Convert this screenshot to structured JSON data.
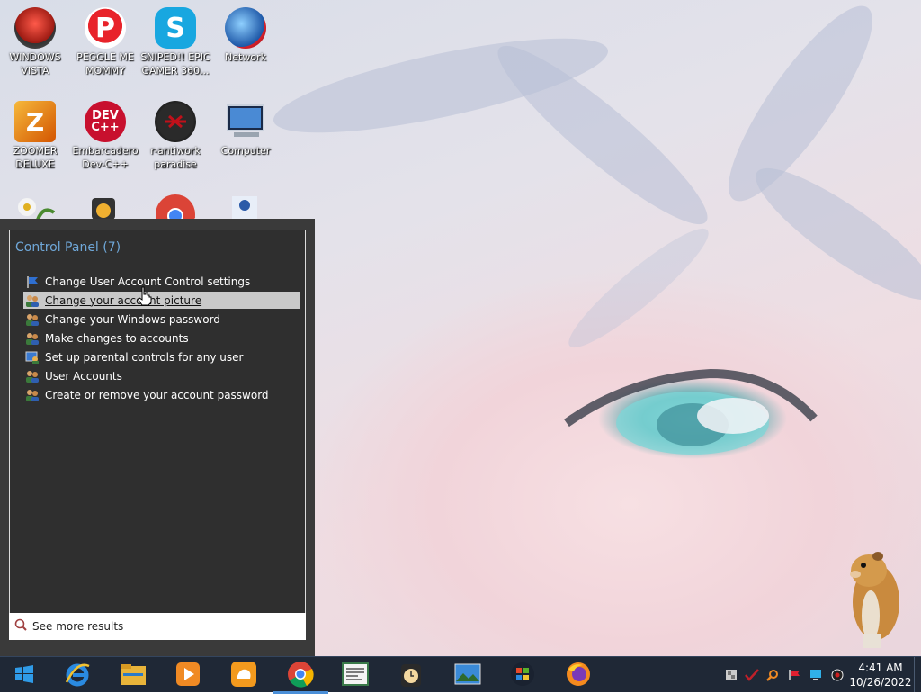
{
  "desktop": {
    "icons": [
      {
        "label": "WINDOWS VISTA",
        "icon": "vista-orb-icon",
        "color": "#c0392b"
      },
      {
        "label": "PEGGLE ME MOMMY",
        "icon": "peggle-icon",
        "color": "#d81f26"
      },
      {
        "label": "SNIPED!! EPIC GAMER 360...",
        "icon": "skype-icon",
        "color": "#18a7e0"
      },
      {
        "label": "Network",
        "icon": "network-globe-icon",
        "color": "#2b6fb5"
      },
      {
        "label": "ZOOMER DELUXE",
        "icon": "zoomer-icon",
        "color": "#e58b1a"
      },
      {
        "label": "Embarcadero Dev-C++",
        "icon": "devcpp-icon",
        "color": "#c8102e"
      },
      {
        "label": "r-antiwork paradise",
        "icon": "antiwork-icon",
        "color": "#111111"
      },
      {
        "label": "Computer",
        "icon": "computer-icon",
        "color": "#3a6aa0"
      }
    ],
    "devcpp_text": "DEV\nC++"
  },
  "search_panel": {
    "group_header": "Control Panel (7)",
    "results": [
      {
        "label": "Change User Account Control settings",
        "icon": "uac-flag-icon"
      },
      {
        "label": "Change your account picture",
        "icon": "users-icon",
        "hovered": true
      },
      {
        "label": "Change your Windows password",
        "icon": "users-icon"
      },
      {
        "label": "Make changes to accounts",
        "icon": "users-icon"
      },
      {
        "label": "Set up parental controls for any user",
        "icon": "parental-controls-icon"
      },
      {
        "label": "User Accounts",
        "icon": "users-icon"
      },
      {
        "label": "Create or remove your account password",
        "icon": "users-icon"
      }
    ],
    "see_more": "See more results"
  },
  "taskbar": {
    "buttons": [
      {
        "name": "start-button",
        "icon": "windows-logo-icon"
      },
      {
        "name": "internet-explorer",
        "icon": "ie-icon"
      },
      {
        "name": "file-explorer",
        "icon": "folder-icon"
      },
      {
        "name": "media-player",
        "icon": "media-player-icon"
      },
      {
        "name": "uc-browser",
        "icon": "uc-browser-icon"
      },
      {
        "name": "chrome",
        "icon": "chrome-icon",
        "active": true
      },
      {
        "name": "document-viewer",
        "icon": "document-icon"
      },
      {
        "name": "clock-app",
        "icon": "clock-app-icon"
      },
      {
        "name": "photo-viewer",
        "icon": "photo-icon"
      },
      {
        "name": "windows-orb-app",
        "icon": "windows-orb-icon"
      },
      {
        "name": "firefox",
        "icon": "firefox-icon"
      }
    ],
    "clock": {
      "time": "4:41 AM",
      "date": "10/26/2022"
    }
  },
  "colors": {
    "taskbar": "#1f2836",
    "panel": "#3a3a3a",
    "group_header": "#6fa7d8",
    "hover_row": "#c9c9c9"
  }
}
